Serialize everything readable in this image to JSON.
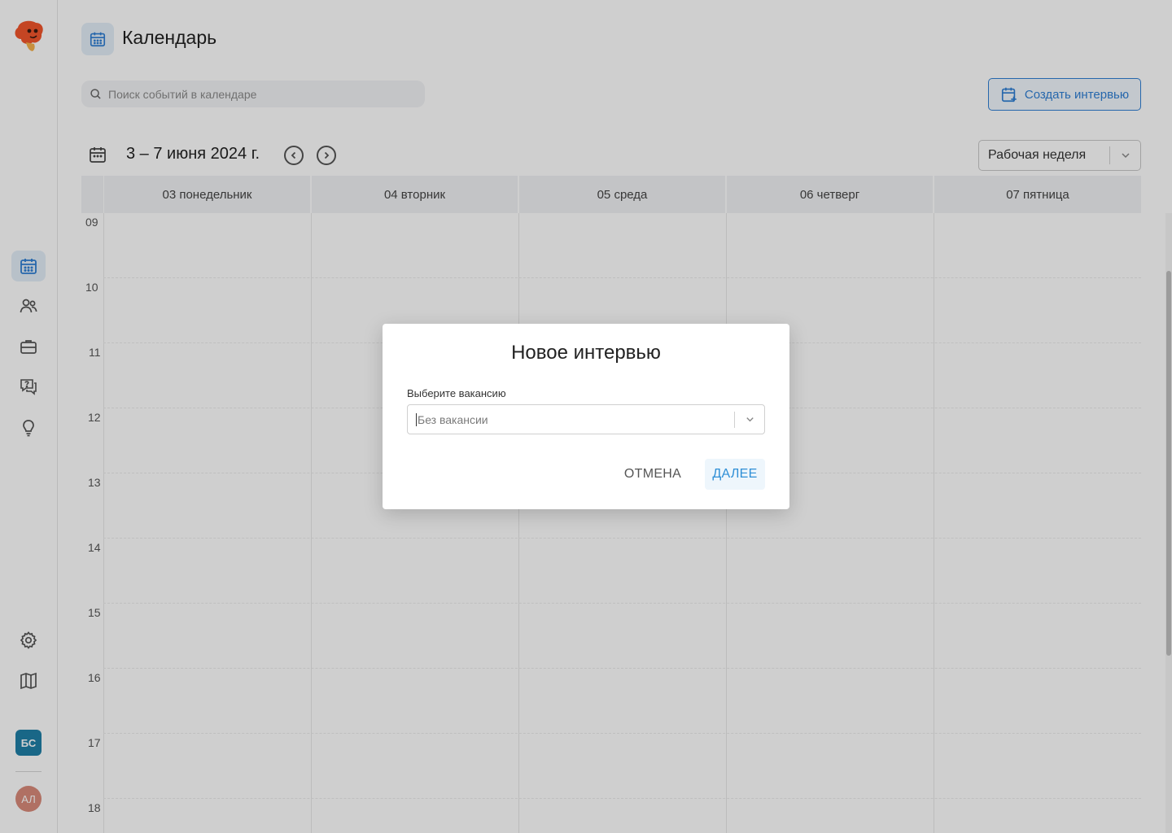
{
  "page": {
    "title": "Календарь"
  },
  "search": {
    "placeholder": "Поиск событий в календаре"
  },
  "toolbar": {
    "create_label": "Создать интервью"
  },
  "date_nav": {
    "range": "3 – 7 июня 2024 г."
  },
  "view_select": {
    "value": "Рабочая неделя"
  },
  "calendar": {
    "days": [
      "03 понедельник",
      "04 вторник",
      "05 среда",
      "06 четверг",
      "07 пятница"
    ],
    "hours": [
      "09",
      "10",
      "11",
      "12",
      "13",
      "14",
      "15",
      "16",
      "17",
      "18"
    ]
  },
  "sidebar": {
    "items": [
      {
        "icon": "calendar-icon",
        "active": true
      },
      {
        "icon": "users-icon",
        "active": false
      },
      {
        "icon": "briefcase-icon",
        "active": false
      },
      {
        "icon": "chat-question-icon",
        "active": false
      },
      {
        "icon": "lightbulb-icon",
        "active": false
      },
      {
        "icon": "gear-icon",
        "active": false
      },
      {
        "icon": "map-icon",
        "active": false
      }
    ],
    "workspace_badge": "БС",
    "user_initials": "АЛ"
  },
  "modal": {
    "title": "Новое интервью",
    "field_label": "Выберите вакансию",
    "vacancy_placeholder": "Без вакансии",
    "cancel_label": "ОТМЕНА",
    "next_label": "ДАЛЕЕ"
  },
  "colors": {
    "accent": "#2f7fd4",
    "badge": "#1f7fa7",
    "avatar": "#d98a7a",
    "header_bg": "#f1f2f4"
  }
}
